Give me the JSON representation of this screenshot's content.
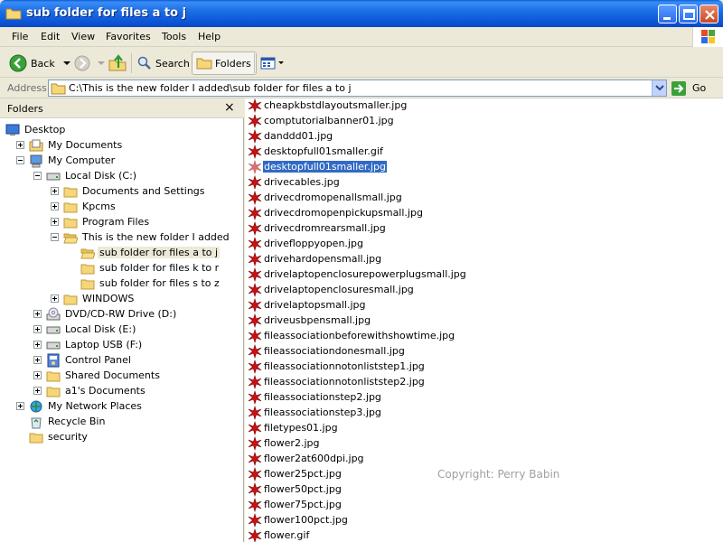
{
  "window": {
    "title": "sub folder for files a to j",
    "buttons": [
      "minimize",
      "maximize",
      "close"
    ]
  },
  "menu": [
    "File",
    "Edit",
    "View",
    "Favorites",
    "Tools",
    "Help"
  ],
  "toolbar": {
    "back": "Back",
    "search": "Search",
    "folders": "Folders"
  },
  "address": {
    "label": "Address",
    "value": "C:\\This is the new folder I added\\sub folder for files a to j",
    "go": "Go"
  },
  "folders_pane": {
    "title": "Folders",
    "close": "×",
    "tree": [
      {
        "label": "Desktop",
        "icon": "desktop-icon",
        "expander": "none",
        "level": 0
      },
      {
        "label": "My Documents",
        "icon": "my-documents-icon",
        "expander": "plus",
        "level": 1
      },
      {
        "label": "My Computer",
        "icon": "my-computer-icon",
        "expander": "minus",
        "level": 1
      },
      {
        "label": "Local Disk (C:)",
        "icon": "hard-drive-icon",
        "expander": "minus",
        "level": 2
      },
      {
        "label": "Documents and Settings",
        "icon": "folder-icon",
        "expander": "plus",
        "level": 3
      },
      {
        "label": "Kpcms",
        "icon": "folder-icon",
        "expander": "plus",
        "level": 3
      },
      {
        "label": "Program Files",
        "icon": "folder-icon",
        "expander": "plus",
        "level": 3
      },
      {
        "label": "This is the new folder I added",
        "icon": "folder-open-icon",
        "expander": "minus",
        "level": 3
      },
      {
        "label": "sub folder for files a to j",
        "icon": "folder-open-icon",
        "expander": "none",
        "level": 4,
        "selected": true
      },
      {
        "label": "sub folder for files k to r",
        "icon": "folder-icon",
        "expander": "none",
        "level": 4
      },
      {
        "label": "sub folder for files s to z",
        "icon": "folder-icon",
        "expander": "none",
        "level": 4
      },
      {
        "label": "WINDOWS",
        "icon": "folder-icon",
        "expander": "plus",
        "level": 3
      },
      {
        "label": "DVD/CD-RW Drive (D:)",
        "icon": "dvd-drive-icon",
        "expander": "plus",
        "level": 2
      },
      {
        "label": "Local Disk (E:)",
        "icon": "hard-drive-icon",
        "expander": "plus",
        "level": 2
      },
      {
        "label": "Laptop USB (F:)",
        "icon": "hard-drive-icon",
        "expander": "plus",
        "level": 2
      },
      {
        "label": "Control Panel",
        "icon": "control-panel-icon",
        "expander": "plus",
        "level": 2
      },
      {
        "label": "Shared Documents",
        "icon": "folder-icon",
        "expander": "plus",
        "level": 2
      },
      {
        "label": "a1's Documents",
        "icon": "folder-icon",
        "expander": "plus",
        "level": 2
      },
      {
        "label": "My Network Places",
        "icon": "network-places-icon",
        "expander": "plus",
        "level": 1
      },
      {
        "label": "Recycle Bin",
        "icon": "recycle-bin-icon",
        "expander": "none",
        "level": 1
      },
      {
        "label": "security",
        "icon": "folder-icon",
        "expander": "none",
        "level": 1
      }
    ]
  },
  "files": [
    {
      "name": "cheapkbstdlayoutsmaller.jpg"
    },
    {
      "name": "comptutorialbanner01.jpg"
    },
    {
      "name": "danddd01.jpg"
    },
    {
      "name": "desktopfull01smaller.gif"
    },
    {
      "name": "desktopfull01smaller.jpg",
      "selected": true
    },
    {
      "name": "drivecables.jpg"
    },
    {
      "name": "drivecdromopenallsmall.jpg"
    },
    {
      "name": "drivecdromopenpickupsmall.jpg"
    },
    {
      "name": "drivecdromrearsmall.jpg"
    },
    {
      "name": "drivefloppyopen.jpg"
    },
    {
      "name": "drivehardopensmall.jpg"
    },
    {
      "name": "drivelaptopenclosurepowerplugsmall.jpg"
    },
    {
      "name": "drivelaptopenclosuresmall.jpg"
    },
    {
      "name": "drivelaptopsmall.jpg"
    },
    {
      "name": "driveusbpensmall.jpg"
    },
    {
      "name": "fileassociationbeforewithshowtime.jpg"
    },
    {
      "name": "fileassociationdonesmall.jpg"
    },
    {
      "name": "fileassociationnotonliststep1.jpg"
    },
    {
      "name": "fileassociationnotonliststep2.jpg"
    },
    {
      "name": "fileassociationstep2.jpg"
    },
    {
      "name": "fileassociationstep3.jpg"
    },
    {
      "name": "filetypes01.jpg"
    },
    {
      "name": "flower2.jpg"
    },
    {
      "name": "flower2at600dpi.jpg"
    },
    {
      "name": "flower25pct.jpg"
    },
    {
      "name": "flower50pct.jpg"
    },
    {
      "name": "flower75pct.jpg"
    },
    {
      "name": "flower100pct.jpg"
    },
    {
      "name": "flower.gif"
    }
  ],
  "file_icon": "image-file-icon",
  "watermark": "Copyright: Perry Babin",
  "colors": {
    "title_bar": "#0b52d4",
    "selection": "#316ac5",
    "folder": "#f5d77a",
    "file_icon": "#cc1111"
  }
}
